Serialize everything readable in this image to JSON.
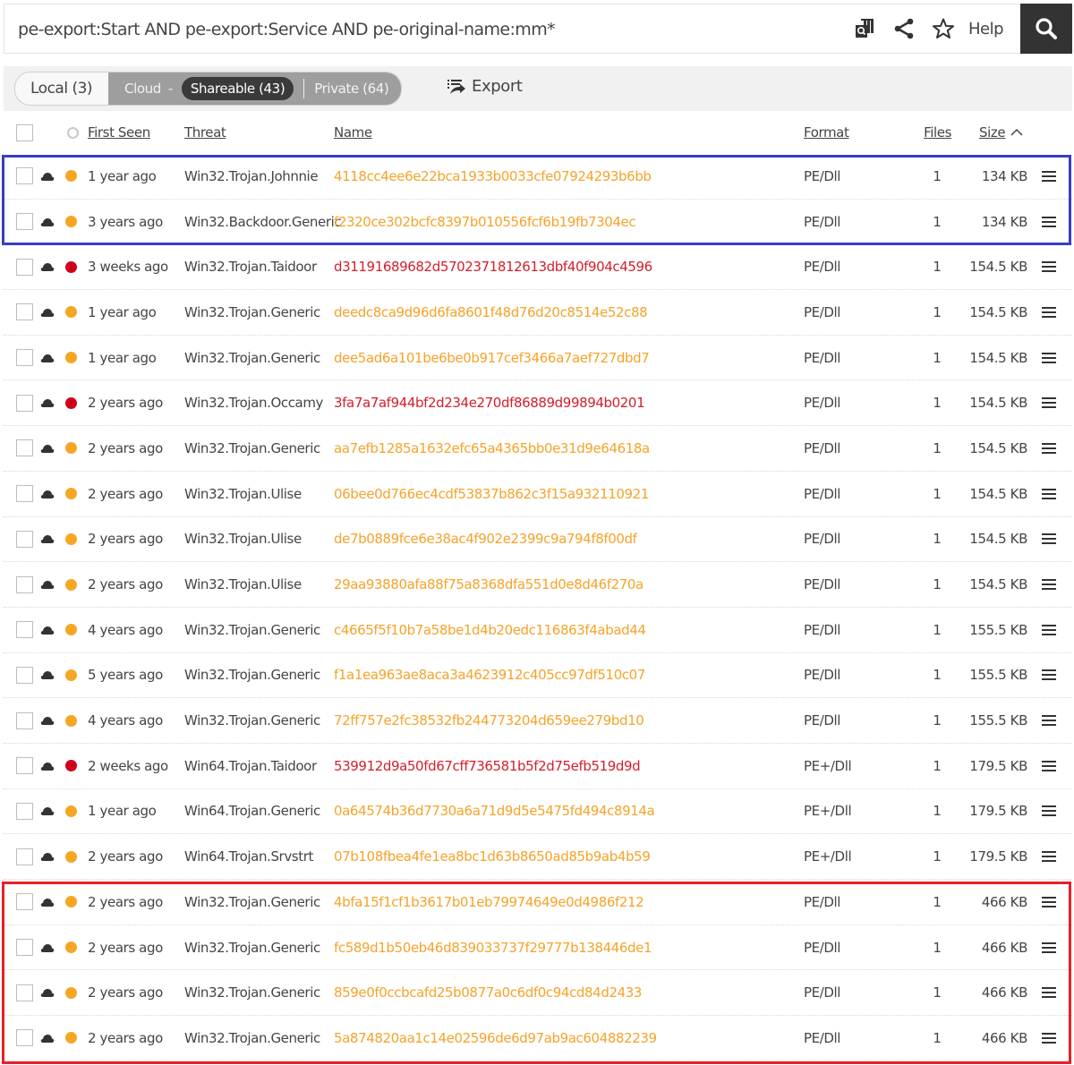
{
  "search": {
    "query": "pe-export:Start AND pe-export:Service AND pe-original-name:mm*",
    "tools": [
      "bulk-search-icon",
      "share-icon",
      "star-icon"
    ],
    "help_label": "Help",
    "search_icon": "magnifier-icon"
  },
  "filters": {
    "local_label": "Local (3)",
    "cloud_label": "Cloud",
    "cloud_dash": "-",
    "shareable_label": "Shareable (43)",
    "private_label": "Private (64)",
    "export_label": "Export"
  },
  "colors": {
    "orange": "#f5a623",
    "red": "#d0021b",
    "hash_orange": "#f5a32a",
    "hash_red": "#d31f2a",
    "highlight_blue": "#3a3dc4",
    "highlight_red": "#e8202b"
  },
  "table": {
    "headers": {
      "first_seen": "First Seen",
      "threat": "Threat",
      "name": "Name",
      "format": "Format",
      "files": "Files",
      "size": "Size",
      "size_sort": "ascending"
    },
    "rows": [
      {
        "first_seen": "1 year ago",
        "threat": "Win32.Trojan.Johnnie",
        "name": "4118cc4ee6e22bca1933b0033cfe07924293b6bb",
        "format": "PE/Dll",
        "files": "1",
        "size": "134 KB",
        "severity": "orange"
      },
      {
        "first_seen": "3 years ago",
        "threat": "Win32.Backdoor.Generic",
        "name": "f2320ce302bcfc8397b010556fcf6b19fb7304ec",
        "format": "PE/Dll",
        "files": "1",
        "size": "134 KB",
        "severity": "orange"
      },
      {
        "first_seen": "3 weeks ago",
        "threat": "Win32.Trojan.Taidoor",
        "name": "d31191689682d5702371812613dbf40f904c4596",
        "format": "PE/Dll",
        "files": "1",
        "size": "154.5 KB",
        "severity": "red"
      },
      {
        "first_seen": "1 year ago",
        "threat": "Win32.Trojan.Generic",
        "name": "deedc8ca9d96d6fa8601f48d76d20c8514e52c88",
        "format": "PE/Dll",
        "files": "1",
        "size": "154.5 KB",
        "severity": "orange"
      },
      {
        "first_seen": "1 year ago",
        "threat": "Win32.Trojan.Generic",
        "name": "dee5ad6a101be6be0b917cef3466a7aef727dbd7",
        "format": "PE/Dll",
        "files": "1",
        "size": "154.5 KB",
        "severity": "orange"
      },
      {
        "first_seen": "2 years ago",
        "threat": "Win32.Trojan.Occamy",
        "name": "3fa7a7af944bf2d234e270df86889d99894b0201",
        "format": "PE/Dll",
        "files": "1",
        "size": "154.5 KB",
        "severity": "red"
      },
      {
        "first_seen": "2 years ago",
        "threat": "Win32.Trojan.Generic",
        "name": "aa7efb1285a1632efc65a4365bb0e31d9e64618a",
        "format": "PE/Dll",
        "files": "1",
        "size": "154.5 KB",
        "severity": "orange"
      },
      {
        "first_seen": "2 years ago",
        "threat": "Win32.Trojan.Ulise",
        "name": "06bee0d766ec4cdf53837b862c3f15a932110921",
        "format": "PE/Dll",
        "files": "1",
        "size": "154.5 KB",
        "severity": "orange"
      },
      {
        "first_seen": "2 years ago",
        "threat": "Win32.Trojan.Ulise",
        "name": "de7b0889fce6e38ac4f902e2399c9a794f8f00df",
        "format": "PE/Dll",
        "files": "1",
        "size": "154.5 KB",
        "severity": "orange"
      },
      {
        "first_seen": "2 years ago",
        "threat": "Win32.Trojan.Ulise",
        "name": "29aa93880afa88f75a8368dfa551d0e8d46f270a",
        "format": "PE/Dll",
        "files": "1",
        "size": "154.5 KB",
        "severity": "orange"
      },
      {
        "first_seen": "4 years ago",
        "threat": "Win32.Trojan.Generic",
        "name": "c4665f5f10b7a58be1d4b20edc116863f4abad44",
        "format": "PE/Dll",
        "files": "1",
        "size": "155.5 KB",
        "severity": "orange"
      },
      {
        "first_seen": "5 years ago",
        "threat": "Win32.Trojan.Generic",
        "name": "f1a1ea963ae8aca3a4623912c405cc97df510c07",
        "format": "PE/Dll",
        "files": "1",
        "size": "155.5 KB",
        "severity": "orange"
      },
      {
        "first_seen": "4 years ago",
        "threat": "Win32.Trojan.Generic",
        "name": "72ff757e2fc38532fb244773204d659ee279bd10",
        "format": "PE/Dll",
        "files": "1",
        "size": "155.5 KB",
        "severity": "orange"
      },
      {
        "first_seen": "2 weeks ago",
        "threat": "Win64.Trojan.Taidoor",
        "name": "539912d9a50fd67cff736581b5f2d75efb519d9d",
        "format": "PE+/Dll",
        "files": "1",
        "size": "179.5 KB",
        "severity": "red"
      },
      {
        "first_seen": "1 year ago",
        "threat": "Win64.Trojan.Generic",
        "name": "0a64574b36d7730a6a71d9d5e5475fd494c8914a",
        "format": "PE+/Dll",
        "files": "1",
        "size": "179.5 KB",
        "severity": "orange"
      },
      {
        "first_seen": "2 years ago",
        "threat": "Win64.Trojan.Srvstrt",
        "name": "07b108fbea4fe1ea8bc1d63b8650ad85b9ab4b59",
        "format": "PE+/Dll",
        "files": "1",
        "size": "179.5 KB",
        "severity": "orange"
      },
      {
        "first_seen": "2 years ago",
        "threat": "Win32.Trojan.Generic",
        "name": "4bfa15f1cf1b3617b01eb79974649e0d4986f212",
        "format": "PE/Dll",
        "files": "1",
        "size": "466 KB",
        "severity": "orange"
      },
      {
        "first_seen": "2 years ago",
        "threat": "Win32.Trojan.Generic",
        "name": "fc589d1b50eb46d839033737f29777b138446de1",
        "format": "PE/Dll",
        "files": "1",
        "size": "466 KB",
        "severity": "orange"
      },
      {
        "first_seen": "2 years ago",
        "threat": "Win32.Trojan.Generic",
        "name": "859e0f0ccbcafd25b0877a0c6df0c94cd84d2433",
        "format": "PE/Dll",
        "files": "1",
        "size": "466 KB",
        "severity": "orange"
      },
      {
        "first_seen": "2 years ago",
        "threat": "Win32.Trojan.Generic",
        "name": "5a874820aa1c14e02596de6d97ab9ac604882239",
        "format": "PE/Dll",
        "files": "1",
        "size": "466 KB",
        "severity": "orange"
      }
    ]
  },
  "highlights": [
    {
      "color": "blue",
      "rows": [
        0,
        1
      ]
    },
    {
      "color": "red",
      "rows": [
        16,
        17,
        18,
        19
      ]
    }
  ]
}
